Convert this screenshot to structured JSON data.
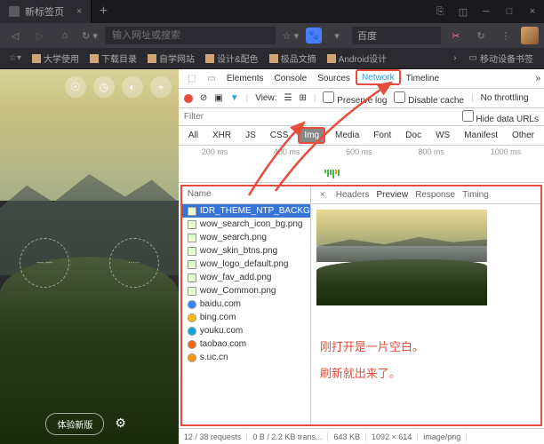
{
  "titlebar": {
    "tab_title": "新标签页"
  },
  "addrbar": {
    "placeholder": "输入网址或搜索",
    "search_engine": "百度"
  },
  "bookmarks": [
    "大学使用",
    "下载目录",
    "自学网站",
    "设计&配色",
    "极品文摘",
    "Android设计"
  ],
  "bookmarks_right": "移动设备书签",
  "left_pane": {
    "btn_label": "体验新版"
  },
  "devtools": {
    "tabs": [
      "Elements",
      "Console",
      "Sources",
      "Network",
      "Timeline"
    ],
    "active_tab": "Network",
    "toolbar": {
      "view_label": "View:",
      "preserve_log": "Preserve log",
      "disable_cache": "Disable cache",
      "throttle": "No throttling"
    },
    "filter_placeholder": "Filter",
    "hide_urls": "Hide data URLs",
    "types": [
      "All",
      "XHR",
      "JS",
      "CSS",
      "Img",
      "Media",
      "Font",
      "Doc",
      "WS",
      "Manifest",
      "Other"
    ],
    "active_type": "Img",
    "timeline_labels": [
      "200 ms",
      "400 ms",
      "600 ms",
      "800 ms",
      "1000 ms"
    ],
    "name_header": "Name",
    "files": [
      {
        "name": "IDR_THEME_NTP_BACKGROUN...",
        "icon": "img",
        "selected": true
      },
      {
        "name": "wow_search_icon_bg.png",
        "icon": "img"
      },
      {
        "name": "wow_search.png",
        "icon": "img"
      },
      {
        "name": "wow_skin_btns.png",
        "icon": "img"
      },
      {
        "name": "wow_logo_default.png",
        "icon": "img"
      },
      {
        "name": "wow_fav_add.png",
        "icon": "img"
      },
      {
        "name": "wow_Common.png",
        "icon": "img"
      },
      {
        "name": "baidu.com",
        "icon": "site",
        "color": "#3385ff"
      },
      {
        "name": "bing.com",
        "icon": "site",
        "color": "#ffb900"
      },
      {
        "name": "youku.com",
        "icon": "site",
        "color": "#06a7e1"
      },
      {
        "name": "taobao.com",
        "icon": "site",
        "color": "#ff6a00"
      },
      {
        "name": "s.uc.cn",
        "icon": "site",
        "color": "#ff9500"
      }
    ],
    "detail_tabs": [
      "Headers",
      "Preview",
      "Response",
      "Timing"
    ],
    "active_detail": "Preview",
    "annotations": [
      "刚打开是一片空白。",
      "刷新就出来了。"
    ],
    "status": {
      "requests": "12 / 38 requests",
      "transfer": "0 B / 2.2 KB trans...",
      "size": "643 KB",
      "dims": "1092 × 614",
      "type": "image/png"
    }
  }
}
